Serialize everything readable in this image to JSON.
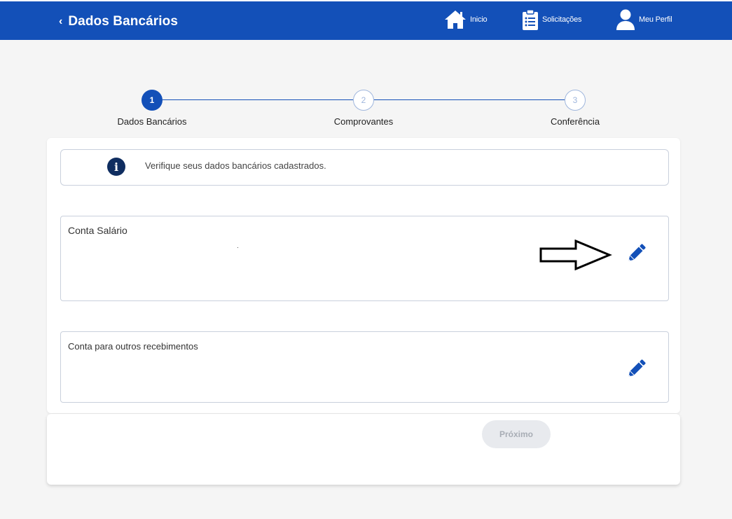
{
  "header": {
    "title": "Dados Bancários",
    "nav": {
      "home": "Inicio",
      "requests": "Solicitações",
      "profile": "Meu Perfil"
    }
  },
  "stepper": {
    "steps": [
      {
        "number": "1",
        "label": "Dados Bancários",
        "active": true
      },
      {
        "number": "2",
        "label": "Comprovantes",
        "active": false
      },
      {
        "number": "3",
        "label": "Conferência",
        "active": false
      }
    ]
  },
  "info": {
    "message": "Verifique seus dados bancários cadastrados."
  },
  "accounts": [
    {
      "label": "Conta Salário"
    },
    {
      "label": "Conta para outros recebimentos"
    }
  ],
  "footer": {
    "next_label": "Próximo"
  },
  "colors": {
    "primary": "#1350b8",
    "info_icon": "#0f2d60",
    "border": "#c9d0dc",
    "button_disabled_bg": "#e8eaee"
  }
}
